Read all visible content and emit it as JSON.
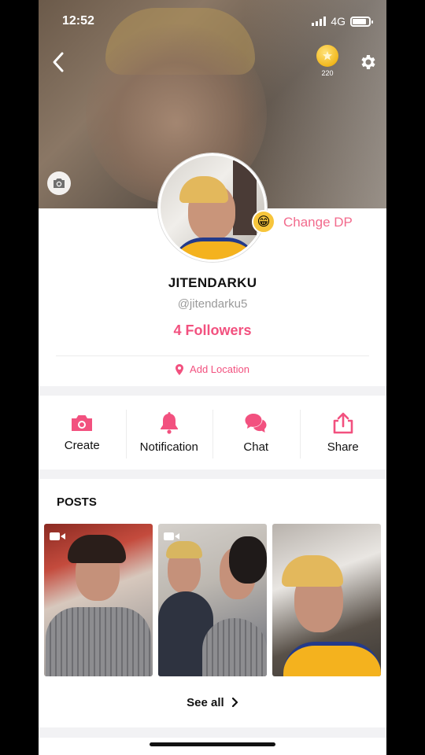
{
  "status": {
    "time": "12:52",
    "network": "4G"
  },
  "header": {
    "coins": "220"
  },
  "profile": {
    "change_dp_label": "Change DP",
    "username": "JITENDARKU",
    "handle": "@jitendarku5",
    "followers": "4 Followers",
    "location_label": "Add Location"
  },
  "actions": [
    {
      "label": "Create",
      "icon": "camera-icon"
    },
    {
      "label": "Notification",
      "icon": "bell-icon"
    },
    {
      "label": "Chat",
      "icon": "chat-icon"
    },
    {
      "label": "Share",
      "icon": "share-icon"
    }
  ],
  "posts": {
    "title": "POSTS",
    "see_all": "See all"
  },
  "colors": {
    "accent": "#f2517f",
    "accent_light": "#f26b8d"
  }
}
